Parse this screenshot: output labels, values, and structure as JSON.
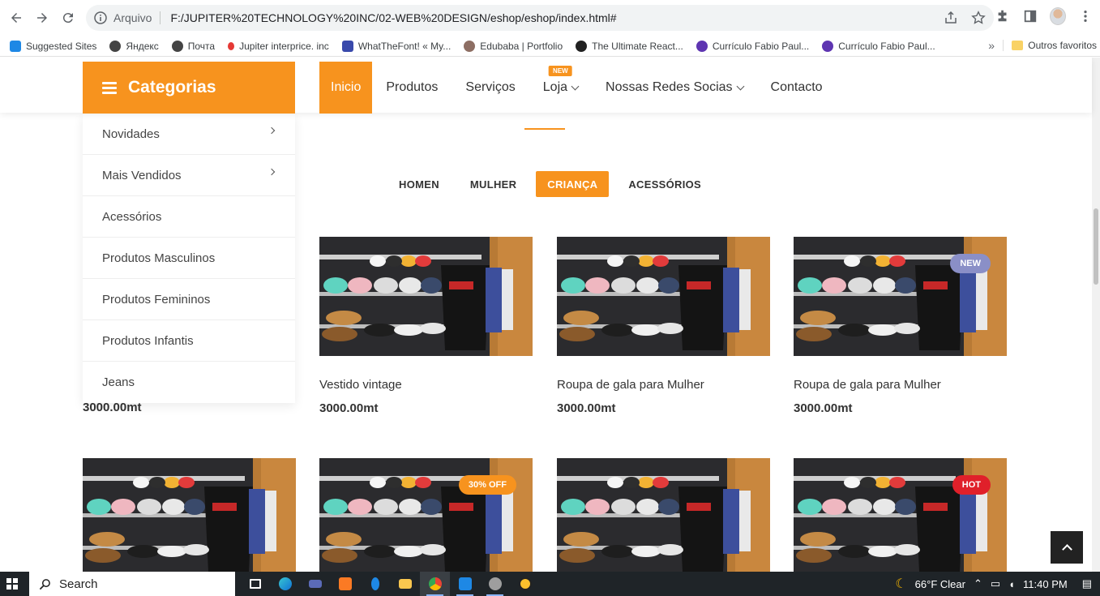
{
  "browser": {
    "scheme_label": "Arquivo",
    "url": "F:/JUPITER%20TECHNOLOGY%20INC/02-WEB%20DESIGN/eshop/eshop/index.html#",
    "bookmarks": [
      {
        "label": "Suggested Sites",
        "color": "#1e88e5"
      },
      {
        "label": "Яндекс",
        "color": "#444444"
      },
      {
        "label": "Почта",
        "color": "#444444"
      },
      {
        "label": "Jupiter interprice. inc",
        "color": "#e53935"
      },
      {
        "label": "WhatTheFont! « My...",
        "color": "#3949ab"
      },
      {
        "label": "Edubaba | Portfolio",
        "color": "#8d6e63"
      },
      {
        "label": "The Ultimate React...",
        "color": "#212121"
      },
      {
        "label": "Currículo Fabio Paul...",
        "color": "#5e35b1"
      },
      {
        "label": "Currículo Fabio Paul...",
        "color": "#5e35b1"
      }
    ],
    "bookmarks_more": "»",
    "other_bookmarks": "Outros favoritos"
  },
  "site": {
    "categories_label": "Categorias",
    "nav": [
      {
        "label": "Inicio"
      },
      {
        "label": "Produtos"
      },
      {
        "label": "Serviços"
      },
      {
        "label": "Loja"
      },
      {
        "label": "Nossas Redes Socias"
      },
      {
        "label": "Contacto"
      }
    ],
    "new_tag": "NEW",
    "sidebar": [
      {
        "label": "Novidades"
      },
      {
        "label": "Mais Vendidos"
      },
      {
        "label": "Acessórios"
      },
      {
        "label": "Produtos Masculinos"
      },
      {
        "label": "Produtos Femininos"
      },
      {
        "label": "Produtos Infantis"
      },
      {
        "label": "Jeans"
      }
    ],
    "tabs": [
      {
        "label": "HOMEN"
      },
      {
        "label": "MULHER"
      },
      {
        "label": "CRIANÇA"
      },
      {
        "label": "ACESSÓRIOS"
      }
    ],
    "hidden_product_price": "3000.00mt",
    "products_row1": [
      {
        "name": "Vestido vintage",
        "price": "3000.00mt",
        "badge": ""
      },
      {
        "name": "Roupa de gala para Mulher",
        "price": "3000.00mt",
        "badge": ""
      },
      {
        "name": "Roupa de gala para Mulher",
        "price": "3000.00mt",
        "badge": "NEW"
      }
    ],
    "products_row2_badges": [
      "",
      "30% OFF",
      "",
      "HOT"
    ],
    "colors": {
      "accent": "#f7931e",
      "badge_new": "#8a8fc7",
      "badge_off": "#f7931e",
      "badge_hot": "#e0202a"
    }
  },
  "taskbar": {
    "search_label": "Search",
    "weather": "66°F  Clear",
    "time": "11:40 PM"
  }
}
